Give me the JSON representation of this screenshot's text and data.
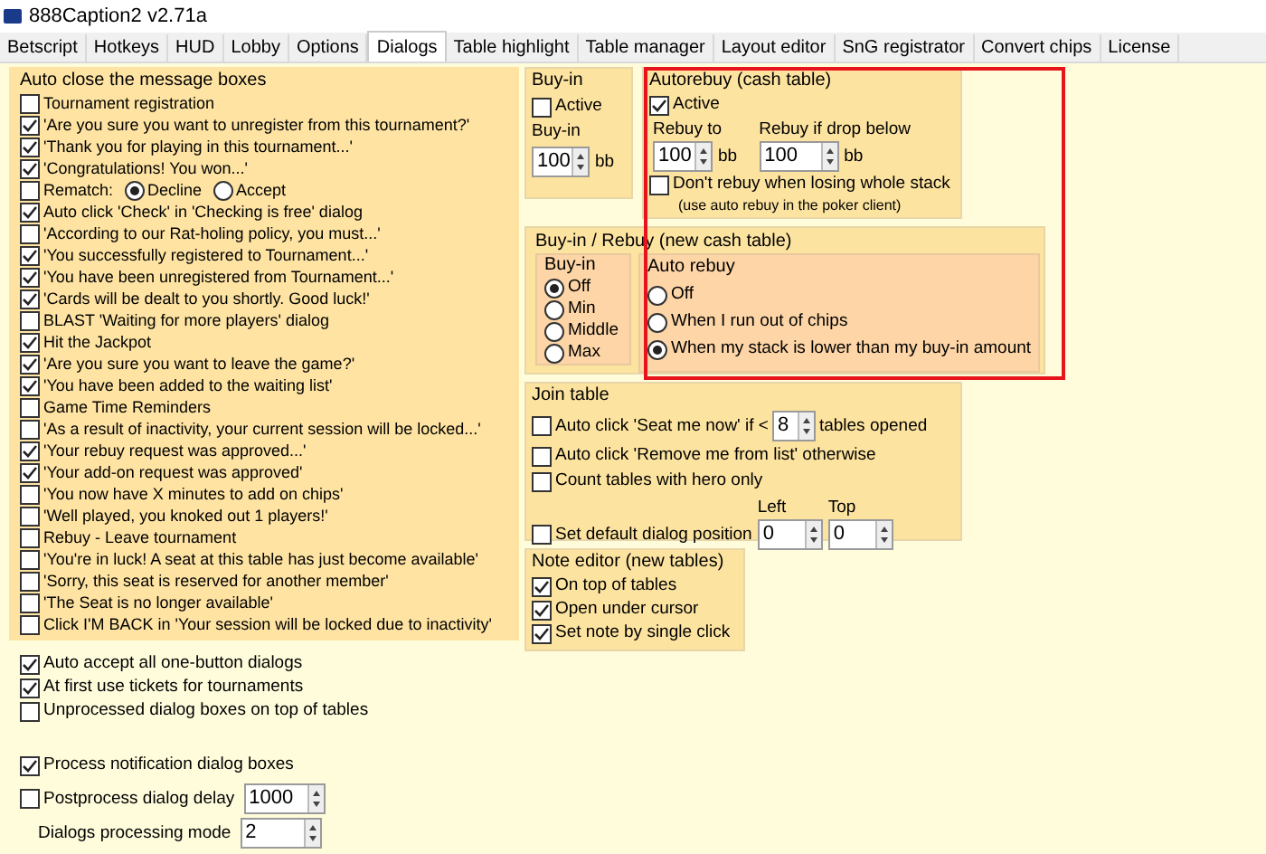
{
  "window": {
    "title": "888Caption2 v2.71a"
  },
  "tabs": [
    {
      "label": "Betscript",
      "selected": false
    },
    {
      "label": "Hotkeys",
      "selected": false
    },
    {
      "label": "HUD",
      "selected": false
    },
    {
      "label": "Lobby",
      "selected": false
    },
    {
      "label": "Options",
      "selected": false
    },
    {
      "label": "Dialogs",
      "selected": true
    },
    {
      "label": "Table highlight",
      "selected": false
    },
    {
      "label": "Table manager",
      "selected": false
    },
    {
      "label": "Layout editor",
      "selected": false
    },
    {
      "label": "SnG registrator",
      "selected": false
    },
    {
      "label": "Convert chips",
      "selected": false
    },
    {
      "label": "License",
      "selected": false
    }
  ],
  "auto_close": {
    "title": "Auto close the message boxes",
    "items": [
      {
        "kind": "checkbox",
        "label": "Tournament registration",
        "checked": false
      },
      {
        "kind": "checkbox",
        "label": "'Are you sure you want to unregister from this tournament?'",
        "checked": true
      },
      {
        "kind": "checkbox",
        "label": "'Thank you for playing in this tournament...'",
        "checked": true
      },
      {
        "kind": "checkbox",
        "label": "'Congratulations!  You won...'",
        "checked": true
      },
      {
        "kind": "choice",
        "label": "Rematch:",
        "checked": false,
        "options": [
          {
            "label": "Decline",
            "selected": true
          },
          {
            "label": "Accept",
            "selected": false
          }
        ]
      },
      {
        "kind": "checkbox",
        "label": "Auto click 'Check' in 'Checking is free' dialog",
        "checked": true
      },
      {
        "kind": "checkbox",
        "label": "'According to our Rat-holing policy, you must...'",
        "checked": false
      },
      {
        "kind": "checkbox",
        "label": "'You successfully registered to Tournament...'",
        "checked": true
      },
      {
        "kind": "checkbox",
        "label": "'You have been unregistered from Tournament...'",
        "checked": true
      },
      {
        "kind": "checkbox",
        "label": "'Cards will be dealt to you shortly. Good luck!'",
        "checked": true
      },
      {
        "kind": "checkbox",
        "label": "BLAST 'Waiting for more players' dialog",
        "checked": false
      },
      {
        "kind": "checkbox",
        "label": "Hit the Jackpot",
        "checked": true
      },
      {
        "kind": "checkbox",
        "label": "'Are you sure you want to leave the game?'",
        "checked": true
      },
      {
        "kind": "checkbox",
        "label": "'You have been added to the waiting list'",
        "checked": true
      },
      {
        "kind": "checkbox",
        "label": "Game Time Reminders",
        "checked": false
      },
      {
        "kind": "checkbox",
        "label": "'As a result of inactivity, your current session will be locked...'",
        "checked": false
      },
      {
        "kind": "checkbox",
        "label": "'Your rebuy request was approved...'",
        "checked": true
      },
      {
        "kind": "checkbox",
        "label": "'Your add-on request was approved'",
        "checked": true
      },
      {
        "kind": "checkbox",
        "label": "'You now have X minutes to add on chips'",
        "checked": false
      },
      {
        "kind": "checkbox",
        "label": "'Well played, you knoked out 1 players!'",
        "checked": false
      },
      {
        "kind": "checkbox",
        "label": "Rebuy - Leave tournament",
        "checked": false
      },
      {
        "kind": "checkbox",
        "label": "'You're in luck! A seat at this table has just become available'",
        "checked": false
      },
      {
        "kind": "checkbox",
        "label": "'Sorry, this seat is reserved for another member'",
        "checked": false
      },
      {
        "kind": "checkbox",
        "label": "'The Seat is no longer available'",
        "checked": false
      },
      {
        "kind": "checkbox",
        "label": "Click I'M BACK in 'Your session will be locked due to inactivity'",
        "checked": false
      }
    ]
  },
  "general_options": [
    {
      "label": "Auto accept all one-button dialogs",
      "checked": true
    },
    {
      "label": "At first use tickets for tournaments",
      "checked": true
    },
    {
      "label": "Unprocessed dialog boxes on top of tables",
      "checked": false
    }
  ],
  "processing": [
    {
      "kind": "checkbox",
      "label": "Process notification dialog boxes",
      "checked": true
    },
    {
      "kind": "checkbox_spin",
      "label": "Postprocess dialog delay",
      "checked": false,
      "value": "1000"
    },
    {
      "kind": "spin",
      "label": "Dialogs processing mode",
      "value": "2"
    }
  ],
  "buy_in": {
    "title": "Buy-in",
    "active": {
      "label": "Active",
      "checked": false
    },
    "field_label": "Buy-in",
    "value": "100",
    "unit": "bb"
  },
  "autorebuy": {
    "title": "Autorebuy (cash table)",
    "active": {
      "label": "Active",
      "checked": true
    },
    "rebuy_to": {
      "label": "Rebuy to",
      "value": "100",
      "unit": "bb"
    },
    "rebuy_if_drop_below": {
      "label": "Rebuy if drop below",
      "value": "100",
      "unit": "bb"
    },
    "dont_rebuy": {
      "label": "Don't rebuy when losing whole stack",
      "checked": false
    },
    "note": "(use auto rebuy in the poker client)"
  },
  "buyin_rebuy": {
    "title": "Buy-in / Rebuy (new cash table)",
    "buy_in": {
      "title": "Buy-in",
      "options": [
        {
          "label": "Off",
          "selected": true
        },
        {
          "label": "Min",
          "selected": false
        },
        {
          "label": "Middle",
          "selected": false
        },
        {
          "label": "Max",
          "selected": false
        }
      ]
    },
    "auto_rebuy": {
      "title": "Auto rebuy",
      "options": [
        {
          "label": "Off",
          "selected": false
        },
        {
          "label": "When I run out of chips",
          "selected": false
        },
        {
          "label": "When my stack is lower than my buy-in amount",
          "selected": true
        }
      ]
    }
  },
  "join_table": {
    "title": "Join table",
    "seat_now": {
      "label": "Auto click 'Seat me now' if <",
      "checked": false,
      "value": "8",
      "suffix": "tables opened"
    },
    "items": [
      {
        "label": "Auto click 'Remove me from list' otherwise",
        "checked": false
      },
      {
        "label": "Count tables with hero only",
        "checked": false
      }
    ],
    "position": {
      "label": "Set default dialog position",
      "checked": false,
      "left": {
        "label": "Left",
        "value": "0"
      },
      "top": {
        "label": "Top",
        "value": "0"
      }
    }
  },
  "note_editor": {
    "title": "Note editor (new tables)",
    "items": [
      {
        "label": "On top of tables",
        "checked": true
      },
      {
        "label": "Open under cursor",
        "checked": true
      },
      {
        "label": "Set note by single click",
        "checked": true
      }
    ]
  }
}
